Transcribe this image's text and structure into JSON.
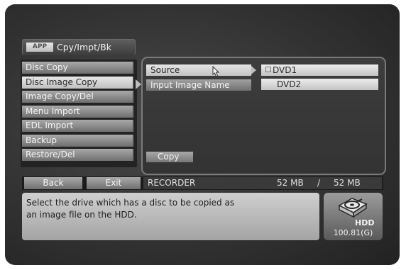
{
  "app": {
    "badge": "APP",
    "title": "Cpy/Impt/Bk"
  },
  "left_menu": {
    "items": [
      {
        "label": "Disc Copy",
        "selected": false
      },
      {
        "label": "Disc Image Copy",
        "selected": true
      },
      {
        "label": "Image Copy/Del",
        "selected": false
      },
      {
        "label": "Menu Import",
        "selected": false
      },
      {
        "label": "EDL Import",
        "selected": false
      },
      {
        "label": "Backup",
        "selected": false
      },
      {
        "label": "Restore/Del",
        "selected": false
      }
    ]
  },
  "main": {
    "source_label": "Source",
    "input_image_name_label": "Input Image Name",
    "drives": [
      "DVD1",
      "DVD2"
    ],
    "copy_label": "Copy"
  },
  "bottom_bar": {
    "back_label": "Back",
    "exit_label": "Exit",
    "recorder_label": "RECORDER",
    "storage_used": "52 MB",
    "storage_separator": "/",
    "storage_total": "52 MB"
  },
  "help": {
    "line1": "Select the drive which has a disc to be copied as",
    "line2": "an image file on the HDD."
  },
  "hdd": {
    "label": "HDD",
    "capacity": "100.81(G)",
    "icon": "hdd-icon"
  }
}
